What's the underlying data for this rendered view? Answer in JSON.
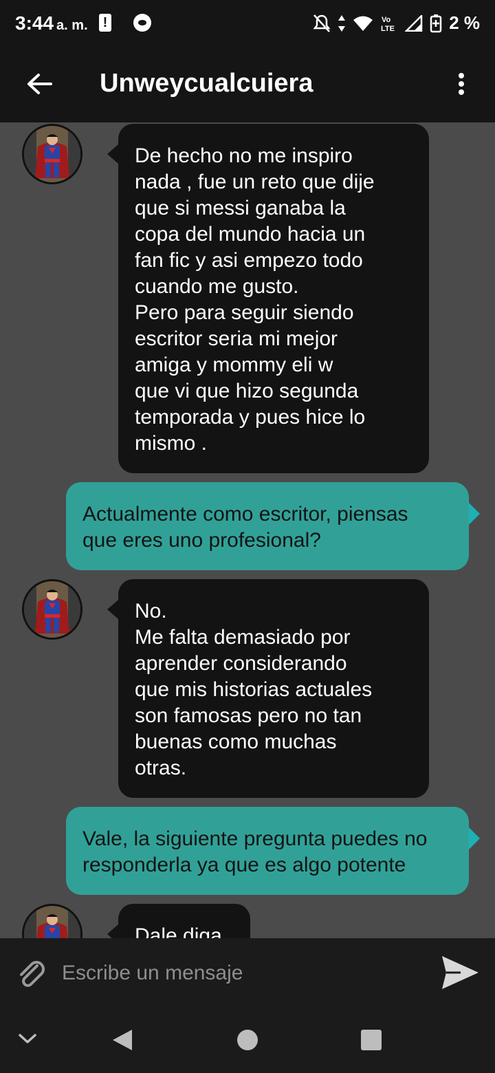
{
  "status_bar": {
    "time": "3:44",
    "ampm": "a. m.",
    "alert_glyph": "!",
    "battery": "2 %",
    "icons": [
      "alert-icon",
      "app-icon",
      "mute-icon",
      "data-arrows-icon",
      "wifi-icon",
      "volte-icon",
      "signal-icon",
      "battery-icon"
    ]
  },
  "app_bar": {
    "title": "Unweycualcuiera",
    "back_icon": "arrow-left-icon",
    "menu_icon": "more-vertical-icon"
  },
  "messages": [
    {
      "side": "in",
      "text": "De hecho no me inspiro\nnada , fue un reto que dije\nque si messi ganaba la\ncopa del mundo hacia un\nfan fic y asi empezo todo\ncuando me gusto.\nPero para seguir siendo\nescritor seria mi mejor\namiga y mommy eli w\nque vi que hizo segunda\ntemporada y pues hice lo\nmismo ."
    },
    {
      "side": "out",
      "text": "Actualmente como escritor, piensas\nque eres uno profesional?"
    },
    {
      "side": "in",
      "text": "No.\nMe falta demasiado por\naprender considerando\nque mis historias actuales\nson famosas pero no tan\nbuenas como muchas\notras."
    },
    {
      "side": "out",
      "text": "Vale, la siguiente pregunta puedes no\nresponderla ya que es algo potente"
    },
    {
      "side": "in",
      "text": "Dale diga"
    }
  ],
  "composer": {
    "placeholder": "Escribe un mensaje",
    "attach_icon": "paperclip-icon",
    "send_icon": "send-icon"
  },
  "nav_bar": {
    "icons": [
      "chevron-down-icon",
      "back-triangle-icon",
      "home-circle-icon",
      "recents-square-icon"
    ]
  },
  "colors": {
    "background": "#4b4b4b",
    "bars": "#151515",
    "incoming_bubble": "#131313",
    "outgoing_bubble": "#31a198",
    "outgoing_tail": "#1fb0b4"
  }
}
